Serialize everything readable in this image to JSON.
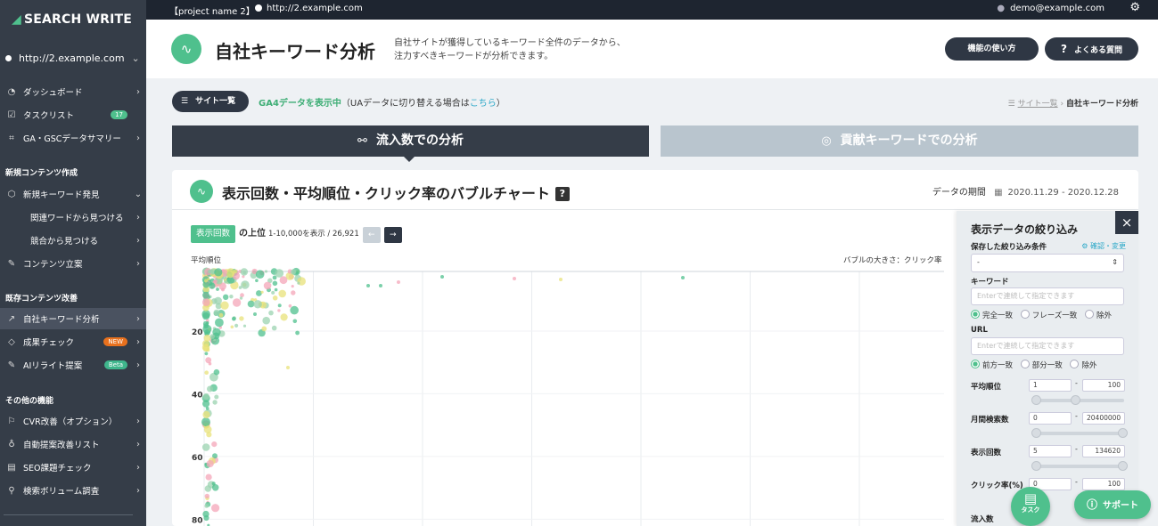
{
  "topbar": {
    "project": "【project name 2】",
    "url": "http://2.example.com",
    "user": "demo@example.com",
    "gear_icon": "gear-icon"
  },
  "sidebar": {
    "logo": "SEARCH WRITE",
    "site": "http://2.example.com",
    "top_items": [
      {
        "label": "ダッシュボード",
        "icon": "gauge-icon"
      },
      {
        "label": "タスクリスト",
        "icon": "checkbox-icon",
        "badge": "17"
      },
      {
        "label": "GA・GSCデータサマリー",
        "icon": "chart-icon"
      }
    ],
    "sec_new": "新規コンテンツ作成",
    "new_items": [
      {
        "label": "新規キーワード発見",
        "icon": "cube-icon"
      },
      {
        "label": "関連ワードから見つける"
      },
      {
        "label": "競合から見つける"
      },
      {
        "label": "コンテンツ立案",
        "icon": "edit-icon"
      }
    ],
    "sec_existing": "既存コンテンツ改善",
    "existing_items": [
      {
        "label": "自社キーワード分析",
        "icon": "trend-icon"
      },
      {
        "label": "成果チェック",
        "icon": "tag-icon",
        "badge": "NEW"
      },
      {
        "label": "AIリライト提案",
        "icon": "edit-icon",
        "badge": "Beta"
      }
    ],
    "sec_other": "その他の機能",
    "other_items": [
      {
        "label": "CVR改善（オプション）",
        "icon": "flag-icon"
      },
      {
        "label": "自動提案改善リスト",
        "icon": "bulb-icon"
      },
      {
        "label": "SEO課題チェック",
        "icon": "list-icon"
      },
      {
        "label": "検索ボリューム調査",
        "icon": "search-icon"
      }
    ]
  },
  "header": {
    "title": "自社キーワード分析",
    "desc1": "自社サイトが獲得しているキーワード全件のデータから、",
    "desc2": "注力すべきキーワードが分析できます。",
    "howto": "機能の使い方",
    "faq": "よくある質問",
    "faq_icon": "?"
  },
  "toolbar": {
    "site_list": "サイト一覧",
    "ga4": "GA4データを表示中",
    "ua_prefix": "（UAデータに切り替える場合は",
    "ua_link": "こちら",
    "ua_suffix": "）",
    "crumb_link": "サイト一覧",
    "crumb_sep": "›",
    "crumb_current": "自社キーワード分析"
  },
  "tabs": {
    "tab1": "流入数での分析",
    "tab2": "貢献キーワードでの分析"
  },
  "panel": {
    "title": "表示回数・平均順位・クリック率のバブルチャート",
    "help": "?",
    "period_label": "データの期間",
    "period": "2020.11.29 - 2020.12.28",
    "metric_select": "表示回数",
    "top_label": "の上位",
    "count": "1-10,000を表示 / 26,921",
    "prev": "←",
    "next": "→",
    "ylabel": "平均順位",
    "bubble_size": "バブルの大きさ：クリック率"
  },
  "chart_data": {
    "type": "scatter",
    "ylabel": "平均順位",
    "yticks": [
      "20",
      "40",
      "60",
      "80"
    ],
    "ylim": [
      1,
      85
    ],
    "reversed_y": true,
    "colors": [
      "#4fc08d",
      "#f4a6b8",
      "#e8e27a",
      "#9bd3b0"
    ]
  },
  "filter": {
    "title": "表示データの絞り込み",
    "close": "×",
    "saved_label": "保存した絞り込み条件",
    "saved_link": "確認・変更",
    "saved_value": "-",
    "keyword_label": "キーワード",
    "keyword_ph": "Enterで連続して指定できます",
    "kw_opts": [
      "完全一致",
      "フレーズ一致",
      "除外"
    ],
    "url_label": "URL",
    "url_ph": "Enterで連続して指定できます",
    "url_opts": [
      "前方一致",
      "部分一致",
      "除外"
    ],
    "rank_label": "平均順位",
    "rank_min": "1",
    "rank_max": "100",
    "vol_label": "月間検索数",
    "vol_min": "0",
    "vol_max": "20400000",
    "imp_label": "表示回数",
    "imp_min": "5",
    "imp_max": "134620",
    "ctr_label": "クリック率(%)",
    "ctr_min": "0",
    "ctr_max": "100",
    "inflow_label": "流入数"
  },
  "fabs": {
    "task": "タスク",
    "support": "サポート"
  }
}
